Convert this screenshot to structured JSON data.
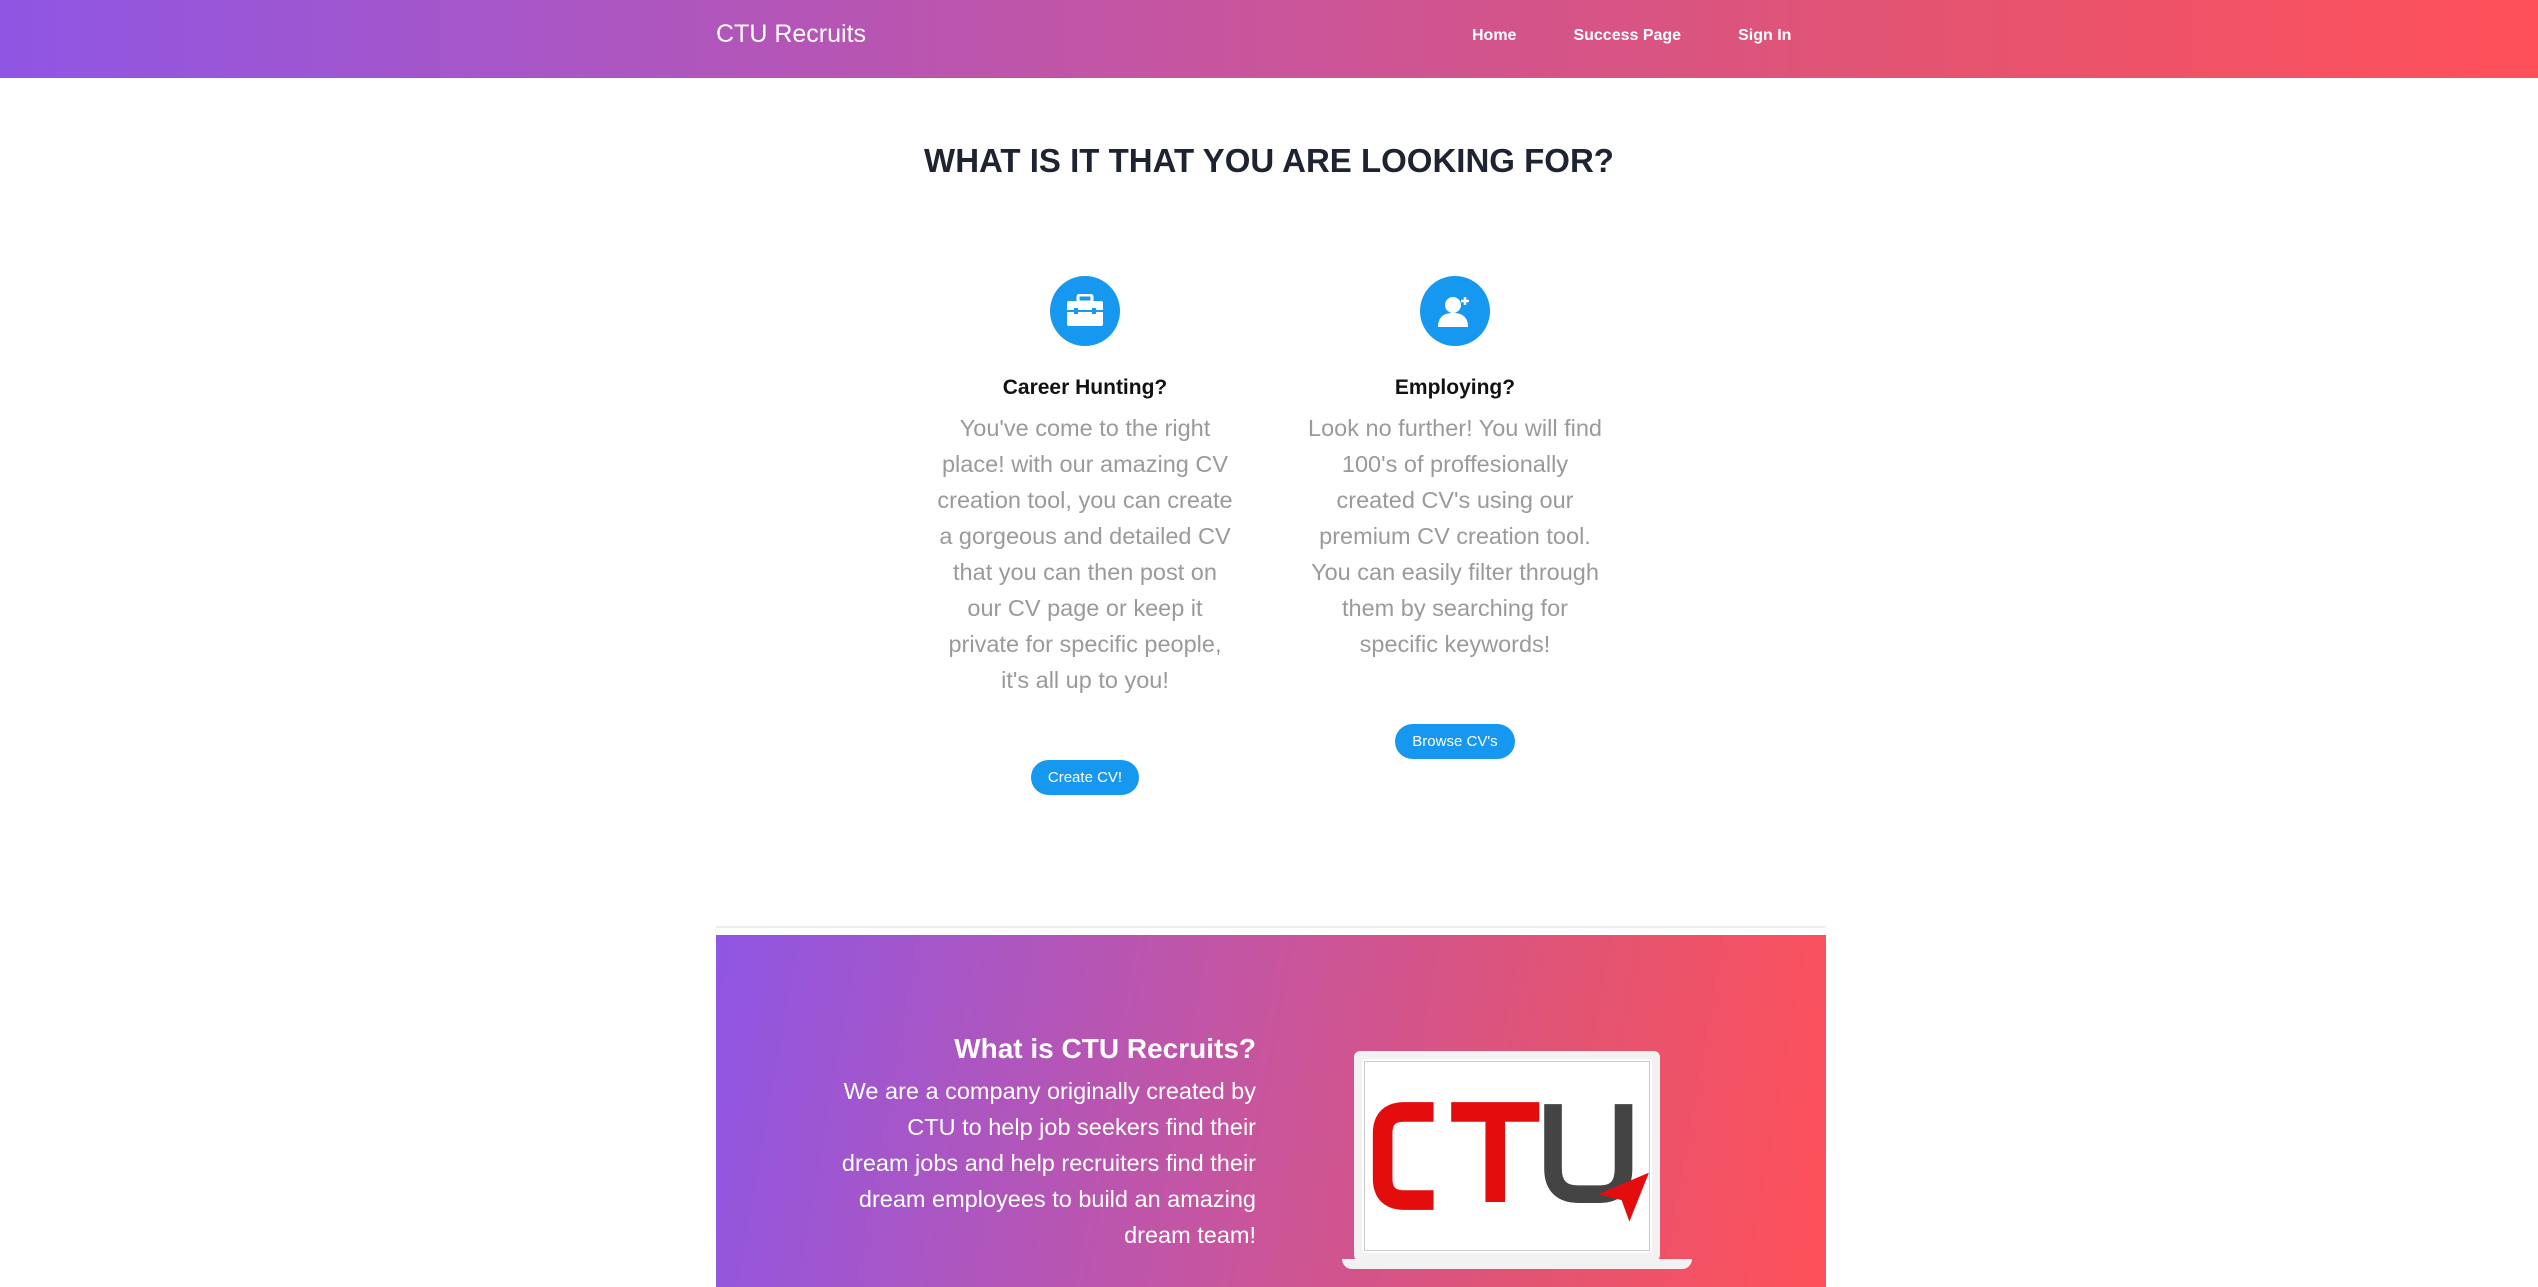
{
  "navbar": {
    "brand": "CTU Recruits",
    "links": [
      "Home",
      "Success Page",
      "Sign In"
    ]
  },
  "main": {
    "heading": "WHAT IS IT THAT YOU ARE LOOKING FOR?",
    "features": [
      {
        "icon": "briefcase-icon",
        "title": "Career Hunting?",
        "text": "You've come to the right place! with our amazing CV creation tool, you can create a gorgeous and detailed CV that you can then post on our CV page or keep it private for specific people, it's all up to you!",
        "button": "Create CV!"
      },
      {
        "icon": "add-user-icon",
        "title": "Employing?",
        "text": "Look no further! You will find 100's of proffesionally created CV's using our premium CV creation tool. You can easily filter through them by searching for specific keywords!",
        "button": "Browse CV's"
      }
    ]
  },
  "about": {
    "title": "What is CTU Recruits?",
    "text": "We are a company originally created by CTU to help job seekers find their dream jobs and help recruiters find their dream employees to build an amazing dream team!",
    "logo_text": "CTU"
  },
  "colors": {
    "accent": "#1798f0",
    "gradient_start": "#8f56e4",
    "gradient_end": "#ff5059",
    "logo_red": "#e30d0d",
    "logo_gray": "#444444"
  }
}
